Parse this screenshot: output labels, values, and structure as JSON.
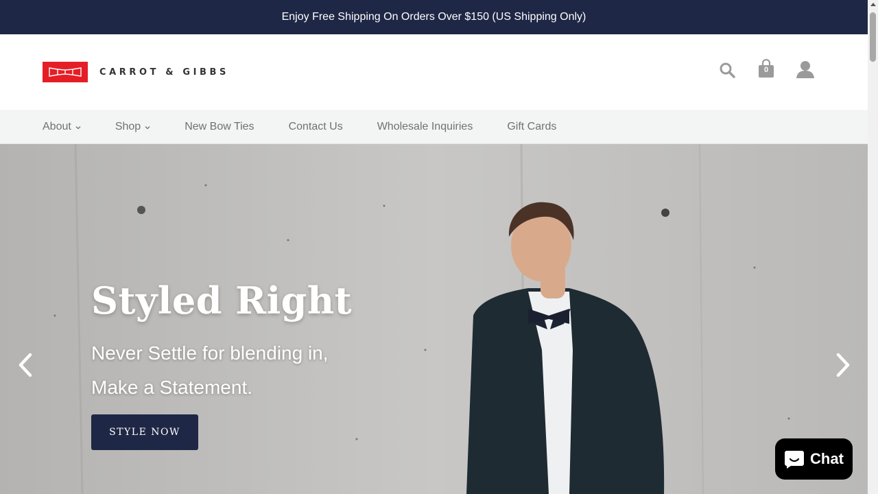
{
  "announcement": "Enjoy Free Shipping On Orders Over $150 (US Shipping Only)",
  "brand": {
    "name": "CARROT & GIBBS",
    "logo_color": "#e51e25"
  },
  "header": {
    "cart_count": "0",
    "icons": [
      "search-icon",
      "cart-icon",
      "account-icon"
    ]
  },
  "nav": {
    "items": [
      {
        "label": "About",
        "has_dropdown": true
      },
      {
        "label": "Shop",
        "has_dropdown": true
      },
      {
        "label": "New Bow Ties",
        "has_dropdown": false
      },
      {
        "label": "Contact Us",
        "has_dropdown": false
      },
      {
        "label": "Wholesale Inquiries",
        "has_dropdown": false
      },
      {
        "label": "Gift Cards",
        "has_dropdown": false
      }
    ]
  },
  "hero": {
    "title": "Styled Right",
    "subtitle_line1": "Never Settle for blending in,",
    "subtitle_line2": "Make a Statement.",
    "button_label": "STYLE NOW"
  },
  "chat": {
    "label": "Chat"
  },
  "colors": {
    "navy": "#1e2745",
    "nav_bg": "#f3f4f4",
    "nav_text": "#6f7173"
  }
}
